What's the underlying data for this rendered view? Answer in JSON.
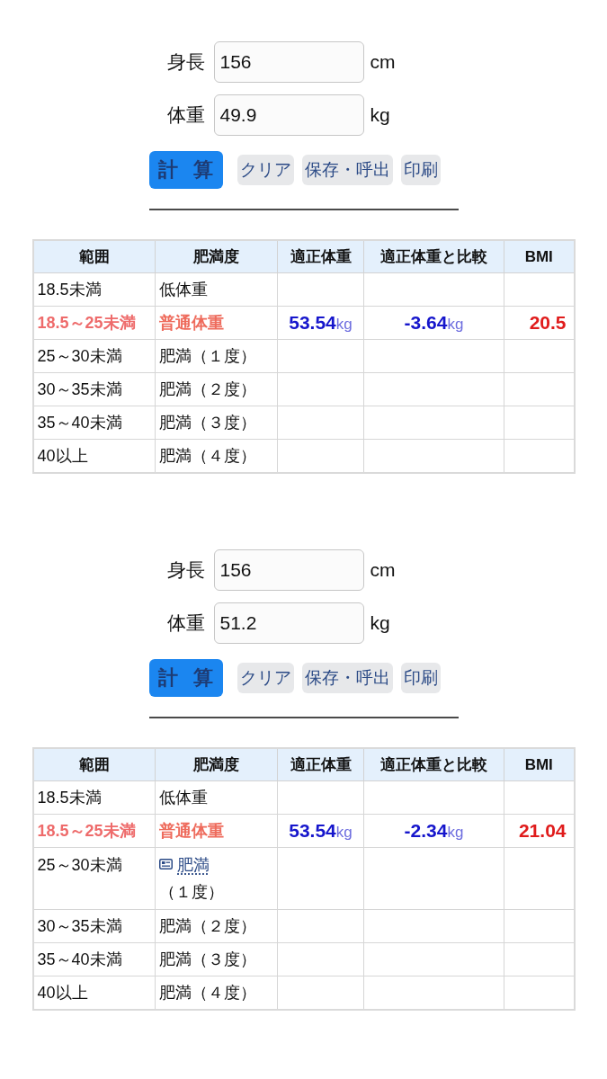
{
  "calculators": [
    {
      "fields": [
        {
          "label": "身長",
          "value": "156",
          "unit": "cm"
        },
        {
          "label": "体重",
          "value": "49.9",
          "unit": "kg"
        }
      ],
      "buttons": [
        {
          "label": "計 算",
          "kind": "primary"
        },
        {
          "label": "クリア",
          "kind": "secondary"
        },
        {
          "label": "保存・呼出",
          "kind": "secondary"
        },
        {
          "label": "印刷",
          "kind": "secondary"
        }
      ],
      "table": {
        "columns": [
          "範囲",
          "肥満度",
          "適正体重",
          "適正体重と比較",
          "BMI"
        ],
        "rows": [
          {
            "range": "18.5未満",
            "category": "低体重",
            "highlighted": false
          },
          {
            "range": "18.5～25未満",
            "category": "普通体重",
            "highlighted": true,
            "ideal_weight": {
              "value": "53.54",
              "unit": "kg"
            },
            "difference": {
              "value": "-3.64",
              "unit": "kg"
            },
            "bmi": "20.5"
          },
          {
            "range": "25～30未満",
            "category": "肥満（１度）",
            "highlighted": false
          },
          {
            "range": "30～35未満",
            "category": "肥満（２度）",
            "highlighted": false
          },
          {
            "range": "35～40未満",
            "category": "肥満（３度）",
            "highlighted": false
          },
          {
            "range": "40以上",
            "category": "肥満（４度）",
            "highlighted": false
          }
        ]
      }
    },
    {
      "fields": [
        {
          "label": "身長",
          "value": "156",
          "unit": "cm"
        },
        {
          "label": "体重",
          "value": "51.2",
          "unit": "kg"
        }
      ],
      "buttons": [
        {
          "label": "計 算",
          "kind": "primary"
        },
        {
          "label": "クリア",
          "kind": "secondary"
        },
        {
          "label": "保存・呼出",
          "kind": "secondary"
        },
        {
          "label": "印刷",
          "kind": "secondary"
        }
      ],
      "table": {
        "columns": [
          "範囲",
          "肥満度",
          "適正体重",
          "適正体重と比較",
          "BMI"
        ],
        "rows": [
          {
            "range": "18.5未満",
            "category": "低体重",
            "highlighted": false
          },
          {
            "range": "18.5～25未満",
            "category": "普通体重",
            "highlighted": true,
            "ideal_weight": {
              "value": "53.54",
              "unit": "kg"
            },
            "difference": {
              "value": "-2.34",
              "unit": "kg"
            },
            "bmi": "21.04"
          },
          {
            "range": "25～30未満",
            "category_link": "肥満",
            "category": "（１度）",
            "highlighted": false
          },
          {
            "range": "30～35未満",
            "category": "肥満（２度）",
            "highlighted": false
          },
          {
            "range": "35～40未満",
            "category": "肥満（３度）",
            "highlighted": false
          },
          {
            "range": "40以上",
            "category": "肥満（４度）",
            "highlighted": false
          }
        ]
      }
    }
  ]
}
